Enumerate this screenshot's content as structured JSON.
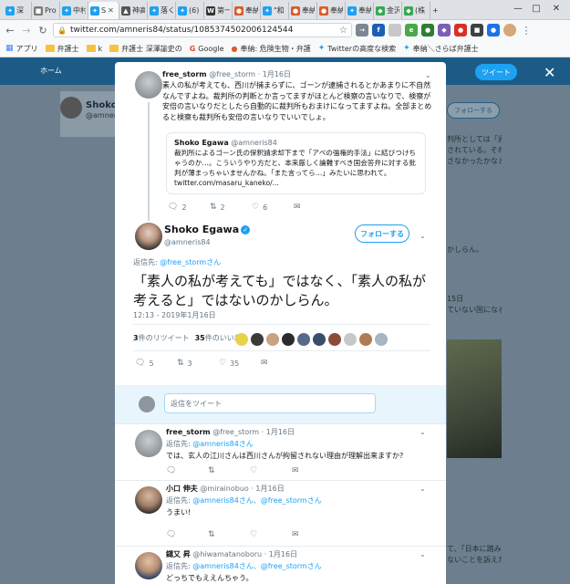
{
  "browser": {
    "tabs": [
      {
        "label": "深",
        "favicon": "twitter",
        "color": "#1da1f2"
      },
      {
        "label": "Pro",
        "favicon": "doc",
        "color": "#7a7a7a"
      },
      {
        "label": "中村",
        "favicon": "twitter",
        "color": "#1da1f2"
      },
      {
        "label": "S",
        "favicon": "twitter",
        "color": "#1da1f2",
        "active": true
      },
      {
        "label": "神高",
        "favicon": "page",
        "color": "#555"
      },
      {
        "label": "落く",
        "favicon": "twitter",
        "color": "#1da1f2"
      },
      {
        "label": "(6)",
        "favicon": "twitter",
        "color": "#1da1f2"
      },
      {
        "label": "第一",
        "favicon": "wiki",
        "color": "#333"
      },
      {
        "label": "奉納",
        "favicon": "blog",
        "color": "#d95c2b"
      },
      {
        "label": "\"和",
        "favicon": "twitter",
        "color": "#1da1f2"
      },
      {
        "label": "奉納",
        "favicon": "blog",
        "color": "#d95c2b"
      },
      {
        "label": "奉納",
        "favicon": "blog",
        "color": "#d95c2b"
      },
      {
        "label": "奉納",
        "favicon": "twitter",
        "color": "#1da1f2"
      },
      {
        "label": "金沢",
        "favicon": "maps",
        "color": "#34a853"
      },
      {
        "label": "(株",
        "favicon": "maps",
        "color": "#34a853"
      }
    ],
    "url": "twitter.com/amneris84/status/1085374502006124544",
    "bookmarks": [
      {
        "label": "アプリ",
        "type": "apps"
      },
      {
        "label": "弁護士",
        "type": "folder"
      },
      {
        "label": "k",
        "type": "folder"
      },
      {
        "label": "弁護士 深澤諭史の",
        "type": "folder"
      },
      {
        "label": "Google",
        "type": "google"
      },
      {
        "label": "奉納: 危険生物・弁護",
        "type": "blog"
      },
      {
        "label": "Twitterの高度な検索",
        "type": "twitter"
      },
      {
        "label": "奉納＼さらば弁護士",
        "type": "twitter"
      }
    ]
  },
  "background": {
    "nav_home": "ホーム",
    "tweet_button": "ツイート",
    "profile_name": "Shoko",
    "profile_handle": "@amneris",
    "follow": "フォローする",
    "right_texts": [
      "判所としては「通常",
      "されている。それ",
      "さなかったかなと",
      "かしらん。",
      "15日",
      "ていない国になる",
      "て、「日本に踏みと",
      "ないことを訴えた方"
    ]
  },
  "thread": {
    "parent": {
      "name": "free_storm",
      "handle": "@free_storm",
      "time": "1月16日",
      "text": "素人の私が考えても、西川が捕まらずに、ゴーンが逮捕されるとかあまりに不自然なんですよね。裁判所の判断とか言ってますがほとんど検察の言いなりで、検察が安倍の言いなりだとしたら自動的に裁判所もおまけになってますよね。全部まとめると検察も裁判所も安倍の言いなりでいいでしょ。",
      "quote": {
        "name": "Shoko Egawa",
        "handle": "@amneris84",
        "text": "裁判所によるゴーン氏の保釈請求却下まで「アベの強権的手法」に結びつけちゃうのか…。こういうやり方だと、本来厳しく論難すべき国会答弁に対する批判が薄まっちゃいませんかね。「また言ってら…」みたいに思われて。",
        "link": "twitter.com/masaru_kaneko/..."
      },
      "replies": "2",
      "retweets": "2",
      "likes": "6"
    },
    "main": {
      "name": "Shoko Egawa",
      "handle": "@amneris84",
      "follow_label": "フォローする",
      "reply_to_prefix": "返信先:",
      "reply_to_user": "@free_stormさん",
      "text": "「素人の私が考えても」ではなく、「素人の私が考えると」ではないのかしらん。",
      "timestamp": "12:13 - 2019年1月16日",
      "retweet_count": "3",
      "retweet_label": "件のリツイート",
      "like_count": "35",
      "like_label": "件のいいね",
      "replies": "5",
      "retweets": "3",
      "likes": "35",
      "liker_colors": [
        "#e8d24a",
        "#3a3a3a",
        "#c9a27f",
        "#2b2b2b",
        "#556b8a",
        "#3b4d6b",
        "#8c4b3a",
        "#c8c8c8",
        "#b07a55",
        "#a8b4c0"
      ]
    },
    "reply_placeholder": "返信をツイート",
    "replies": [
      {
        "name": "free_storm",
        "handle": "@free_storm",
        "time": "1月16日",
        "reply_to_prefix": "返信先:",
        "reply_to": "@amneris84さん",
        "text": "では、玄人の江川さんは西川さんが拘留されない理由が理解出来ますか?",
        "avatar": "grey"
      },
      {
        "name": "小口 伸夫",
        "handle": "@mirainobuo",
        "time": "1月16日",
        "reply_to_prefix": "返信先:",
        "reply_to": "@amneris84さん、@free_stormさん",
        "text": "うまい!",
        "avatar": "man1"
      },
      {
        "name": "鑓又 昇",
        "handle": "@hiwamatanoboru",
        "time": "1月16日",
        "reply_to_prefix": "返信先:",
        "reply_to": "@amneris84さん、@free_stormさん",
        "text": "どっちでもええんちゃう。",
        "avatar": "man2"
      }
    ]
  }
}
